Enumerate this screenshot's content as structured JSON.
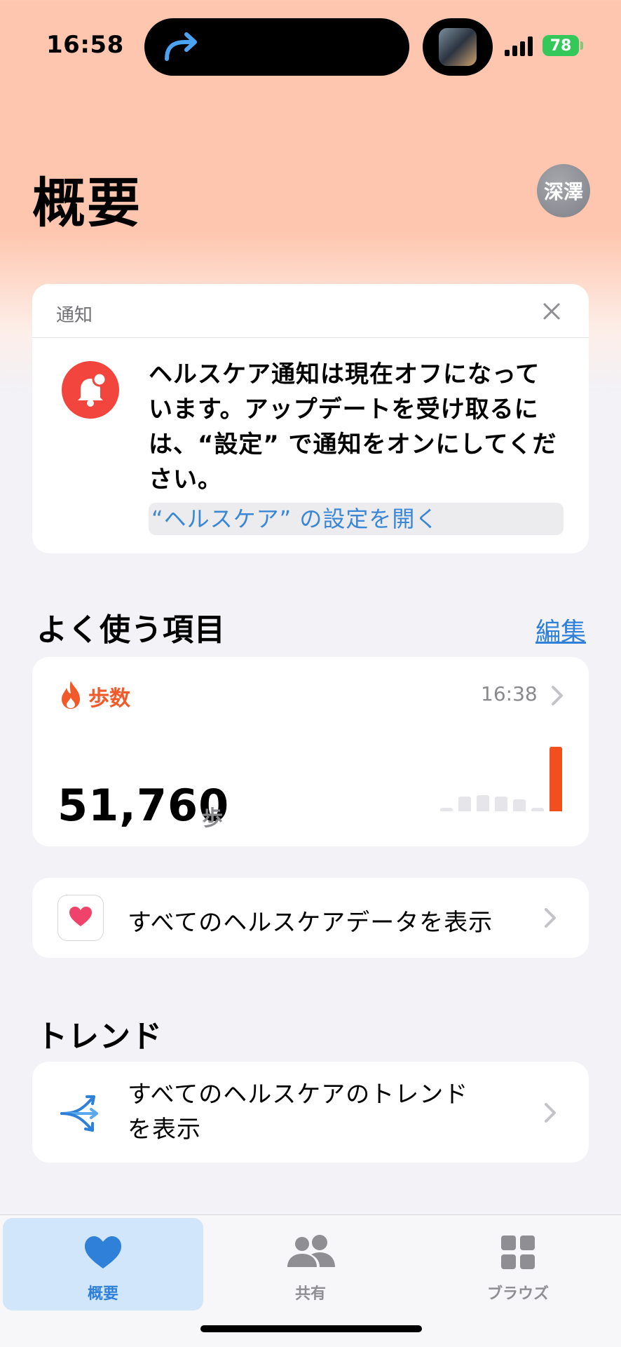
{
  "status_bar": {
    "time": "16:58",
    "battery": "78"
  },
  "header": {
    "title": "概要",
    "avatar_text": "深澤"
  },
  "notification": {
    "header_label": "通知",
    "message": "ヘルスケア通知は現在オフになっています。アップデートを受け取るには、“設定” で通知をオンにしてください。",
    "link": "“ヘルスケア” の設定を開く",
    "icon": "bell-badge-icon"
  },
  "favorites": {
    "title": "よく使う項目",
    "edit_label": "編集",
    "steps": {
      "label": "歩数",
      "time": "16:38",
      "value": "51,760",
      "unit": "歩",
      "chart_levels": [
        0.05,
        0.23,
        0.25,
        0.23,
        0.18,
        0.05,
        1.0
      ],
      "accent": "#f24e1e"
    },
    "all_data": {
      "label": "すべてのヘルスケアデータを表示",
      "icon": "heart-icon"
    }
  },
  "trends": {
    "title": "トレンド",
    "label_line1": "すべてのヘルスケアのトレンド",
    "label_line2": "を表示",
    "icon": "trend-arrows-icon"
  },
  "tab_bar": {
    "tabs": [
      {
        "label": "概要",
        "icon": "heart-icon",
        "active": true
      },
      {
        "label": "共有",
        "icon": "people-icon",
        "active": false
      },
      {
        "label": "ブラウズ",
        "icon": "grid-icon",
        "active": false
      }
    ]
  },
  "colors": {
    "accent": "#2f80d8",
    "header_tint": "#fec6ae",
    "alert_red": "#f2453d"
  }
}
